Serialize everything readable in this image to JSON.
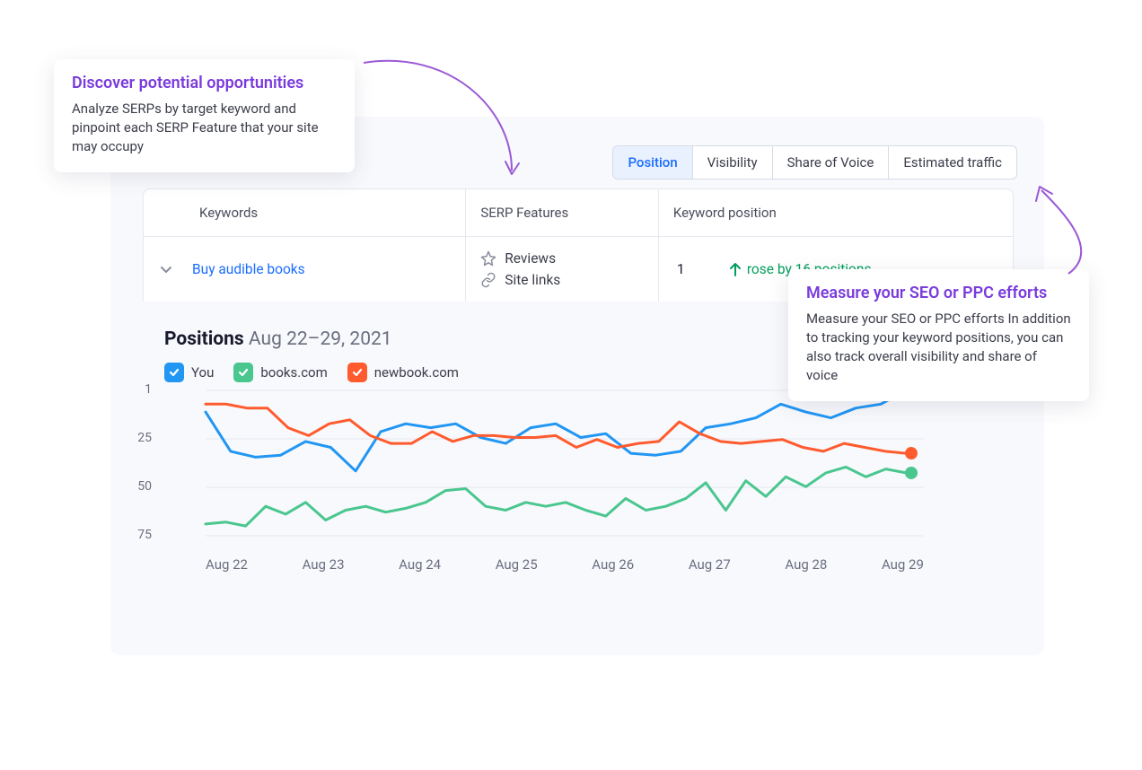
{
  "tabs": {
    "items": [
      {
        "label": "Position",
        "active": true
      },
      {
        "label": "Visibility",
        "active": false
      },
      {
        "label": "Share of Voice",
        "active": false
      },
      {
        "label": "Estimated traffic",
        "active": false
      }
    ]
  },
  "table": {
    "headers": {
      "keywords": "Keywords",
      "serp": "SERP Features",
      "pos": "Keyword position"
    },
    "row": {
      "keyword": "Buy audible books",
      "serp": [
        {
          "icon": "star-icon",
          "label": "Reviews"
        },
        {
          "icon": "link-icon",
          "label": "Site links"
        }
      ],
      "position": "1",
      "change_text": "rose by 16 positions"
    }
  },
  "chart": {
    "title_bold": "Positions",
    "title_range": "Aug 22–29, 2021",
    "legend": [
      {
        "name": "You",
        "color": "#2196f3"
      },
      {
        "name": "books.com",
        "color": "#4ac68f"
      },
      {
        "name": "newbook.com",
        "color": "#ff5b2e"
      }
    ],
    "y_ticks": [
      "1",
      "25",
      "50",
      "75"
    ],
    "x_ticks": [
      "Aug 22",
      "Aug 23",
      "Aug 24",
      "Aug 25",
      "Aug 26",
      "Aug 27",
      "Aug 28",
      "Aug 29"
    ]
  },
  "callouts": {
    "c1": {
      "title": "Discover potential opportunities",
      "body": "Analyze SERPs by target keyword and pinpoint each SERP Feature that your site may occupy"
    },
    "c2": {
      "title": "Measure your SEO or PPC efforts",
      "body": "Measure your SEO or PPC efforts In addition to tracking your keyword positions, you can also track overall visibility and share of voice"
    }
  },
  "chart_data": {
    "type": "line",
    "title": "Positions Aug 22–29, 2021",
    "xlabel": "",
    "ylabel": "",
    "ylim": [
      75,
      1
    ],
    "y_reversed": true,
    "x": [
      "Aug 22",
      "",
      "",
      "Aug 23",
      "",
      "",
      "Aug 24",
      "",
      "",
      "Aug 25",
      "",
      "",
      "Aug 26",
      "",
      "",
      "Aug 27",
      "",
      "",
      "Aug 28",
      "",
      "",
      "Aug 29"
    ],
    "series": [
      {
        "name": "You",
        "color": "#2196f3",
        "values": [
          12,
          32,
          35,
          34,
          27,
          30,
          42,
          22,
          18,
          20,
          18,
          25,
          28,
          20,
          18,
          25,
          23,
          33,
          34,
          32,
          20,
          18,
          15,
          8,
          12,
          15,
          10,
          8,
          1
        ]
      },
      {
        "name": "books.com",
        "color": "#4ac68f",
        "values": [
          69,
          68,
          70,
          60,
          64,
          58,
          67,
          62,
          60,
          63,
          61,
          58,
          52,
          51,
          60,
          62,
          58,
          60,
          58,
          62,
          65,
          56,
          62,
          60,
          56,
          48,
          62,
          47,
          55,
          45,
          50,
          43,
          40,
          45,
          41,
          43
        ]
      },
      {
        "name": "newbook.com",
        "color": "#ff5b2e",
        "values": [
          8,
          8,
          10,
          10,
          20,
          24,
          18,
          16,
          24,
          28,
          28,
          22,
          27,
          24,
          24,
          25,
          25,
          24,
          30,
          26,
          30,
          28,
          27,
          17,
          23,
          27,
          28,
          27,
          26,
          30,
          32,
          28,
          30,
          32,
          33
        ]
      }
    ]
  }
}
